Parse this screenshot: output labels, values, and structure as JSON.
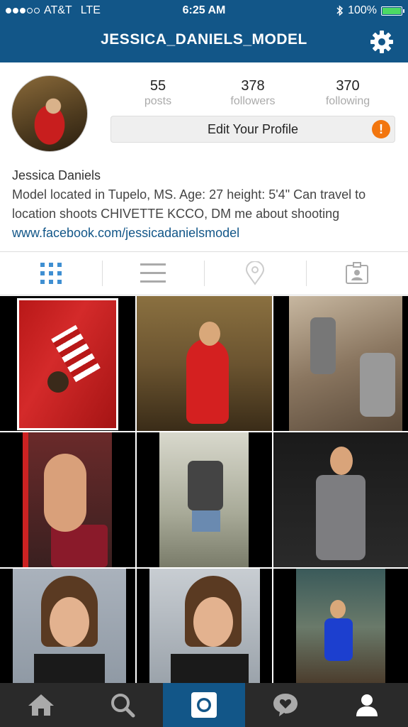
{
  "status": {
    "carrier": "AT&T",
    "network": "LTE",
    "time": "6:25 AM",
    "battery": "100%"
  },
  "header": {
    "title": "JESSICA_DANIELS_MODEL"
  },
  "profile": {
    "stats": [
      {
        "value": "55",
        "label": "posts"
      },
      {
        "value": "378",
        "label": "followers"
      },
      {
        "value": "370",
        "label": "following"
      }
    ],
    "edit_label": "Edit Your Profile",
    "warn_glyph": "!",
    "name": "Jessica Daniels",
    "bio": "Model located in Tupelo, MS. Age: 27 height: 5'4\" Can travel to location shoots CHIVETTE KCCO, DM me about shooting",
    "link": "www.facebook.com/jessicadanielsmodel"
  },
  "tabs": [
    "grid-view-icon",
    "list-view-icon",
    "location-icon",
    "tagged-icon"
  ],
  "nav": [
    "home-icon",
    "search-icon",
    "camera-icon",
    "activity-icon",
    "profile-icon"
  ],
  "colors": {
    "brand": "#125688",
    "warning": "#f2760f",
    "nav_bg": "#2a2a2a"
  }
}
